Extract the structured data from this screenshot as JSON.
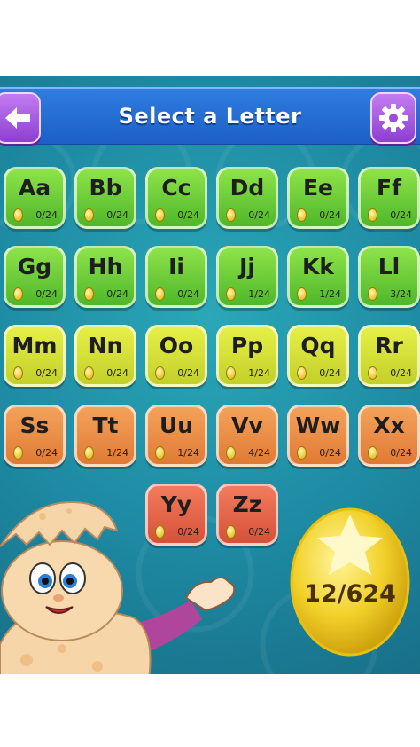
{
  "header": {
    "title": "Select a Letter",
    "back_icon": "back-arrow-icon",
    "settings_icon": "gear-icon",
    "colors": {
      "bar": "#2f7de0",
      "button": "#a55be0"
    }
  },
  "letters": [
    {
      "label": "Aa",
      "score": "0/24",
      "color": "green"
    },
    {
      "label": "Bb",
      "score": "0/24",
      "color": "green"
    },
    {
      "label": "Cc",
      "score": "0/24",
      "color": "green"
    },
    {
      "label": "Dd",
      "score": "0/24",
      "color": "green"
    },
    {
      "label": "Ee",
      "score": "0/24",
      "color": "green"
    },
    {
      "label": "Ff",
      "score": "0/24",
      "color": "green"
    },
    {
      "label": "Gg",
      "score": "0/24",
      "color": "green"
    },
    {
      "label": "Hh",
      "score": "0/24",
      "color": "green"
    },
    {
      "label": "Ii",
      "score": "0/24",
      "color": "green"
    },
    {
      "label": "Jj",
      "score": "1/24",
      "color": "green"
    },
    {
      "label": "Kk",
      "score": "1/24",
      "color": "green"
    },
    {
      "label": "Ll",
      "score": "3/24",
      "color": "green"
    },
    {
      "label": "Mm",
      "score": "0/24",
      "color": "lime"
    },
    {
      "label": "Nn",
      "score": "0/24",
      "color": "lime"
    },
    {
      "label": "Oo",
      "score": "0/24",
      "color": "lime"
    },
    {
      "label": "Pp",
      "score": "1/24",
      "color": "lime"
    },
    {
      "label": "Qq",
      "score": "0/24",
      "color": "lime"
    },
    {
      "label": "Rr",
      "score": "0/24",
      "color": "lime"
    },
    {
      "label": "Ss",
      "score": "0/24",
      "color": "orange"
    },
    {
      "label": "Tt",
      "score": "1/24",
      "color": "orange"
    },
    {
      "label": "Uu",
      "score": "1/24",
      "color": "orange"
    },
    {
      "label": "Vv",
      "score": "4/24",
      "color": "orange"
    },
    {
      "label": "Ww",
      "score": "0/24",
      "color": "orange"
    },
    {
      "label": "Xx",
      "score": "0/24",
      "color": "orange"
    },
    {
      "label": "Yy",
      "score": "0/24",
      "color": "red"
    },
    {
      "label": "Zz",
      "score": "0/24",
      "color": "red"
    }
  ],
  "total": {
    "count": "12/624",
    "icon": "golden-egg-star-icon"
  },
  "mascot": {
    "icon": "hatching-egg-character"
  }
}
